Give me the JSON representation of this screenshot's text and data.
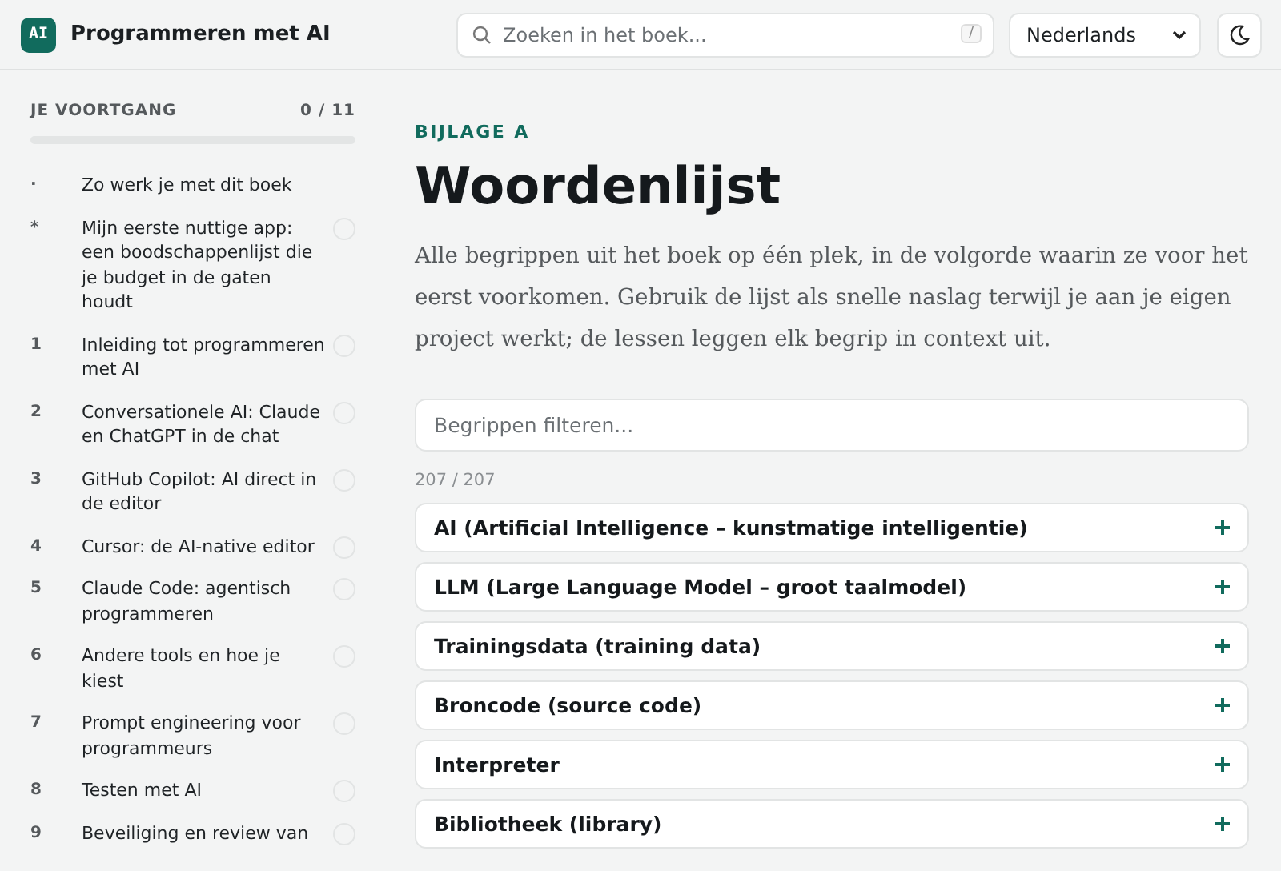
{
  "header": {
    "logo": "AI",
    "title": "Programmeren met AI",
    "search": {
      "placeholder": "Zoeken in het boek...",
      "shortcut": "/"
    },
    "language": "Nederlands"
  },
  "sidebar": {
    "heading": "JE VOORTGANG",
    "count": "0 / 11",
    "progress": {
      "level": 0
    },
    "items": [
      {
        "kind": "preface",
        "marker": "·",
        "label": "Zo werk je met dit boek"
      },
      {
        "kind": "chapter",
        "marker": "*",
        "label": "Mijn eerste nuttige app: een boodschappenlijst die je budget in de gaten houdt",
        "done": false
      },
      {
        "kind": "chapter",
        "marker": "1",
        "label": "Inleiding tot programmeren met AI",
        "done": false
      },
      {
        "kind": "chapter",
        "marker": "2",
        "label": "Conversationele AI: Claude en ChatGPT in de chat",
        "done": false
      },
      {
        "kind": "chapter",
        "marker": "3",
        "label": "GitHub Copilot: AI direct in de editor",
        "done": false
      },
      {
        "kind": "chapter",
        "marker": "4",
        "label": "Cursor: de AI-native editor",
        "done": false
      },
      {
        "kind": "chapter",
        "marker": "5",
        "label": "Claude Code: agentisch programmeren",
        "done": false
      },
      {
        "kind": "chapter",
        "marker": "6",
        "label": "Andere tools en hoe je kiest",
        "done": false
      },
      {
        "kind": "chapter",
        "marker": "7",
        "label": "Prompt engineering voor programmeurs",
        "done": false
      },
      {
        "kind": "chapter",
        "marker": "8",
        "label": "Testen met AI",
        "done": false
      },
      {
        "kind": "chapter",
        "marker": "9",
        "label": "Beveiliging en review van",
        "done": false
      }
    ]
  },
  "main": {
    "eyebrow": "BIJLAGE A",
    "title": "Woordenlijst",
    "intro": "Alle begrippen uit het boek op één plek, in de volgorde waarin ze voor het eerst voorkomen. Gebruik de lijst als snelle naslag terwijl je aan je eigen project werkt; de lessen leggen elk begrip in context uit.",
    "filter": {
      "placeholder": "Begrippen filteren..."
    },
    "count": "207 / 207",
    "terms": [
      {
        "label": "AI (Artificial Intelligence – kunstmatige intelligentie)",
        "expanded": false
      },
      {
        "label": "LLM (Large Language Model – groot taalmodel)",
        "expanded": false
      },
      {
        "label": "Trainingsdata (training data)",
        "expanded": false
      },
      {
        "label": "Broncode (source code)",
        "expanded": false
      },
      {
        "label": "Interpreter",
        "expanded": false
      },
      {
        "label": "Bibliotheek (library)",
        "expanded": false
      }
    ]
  }
}
